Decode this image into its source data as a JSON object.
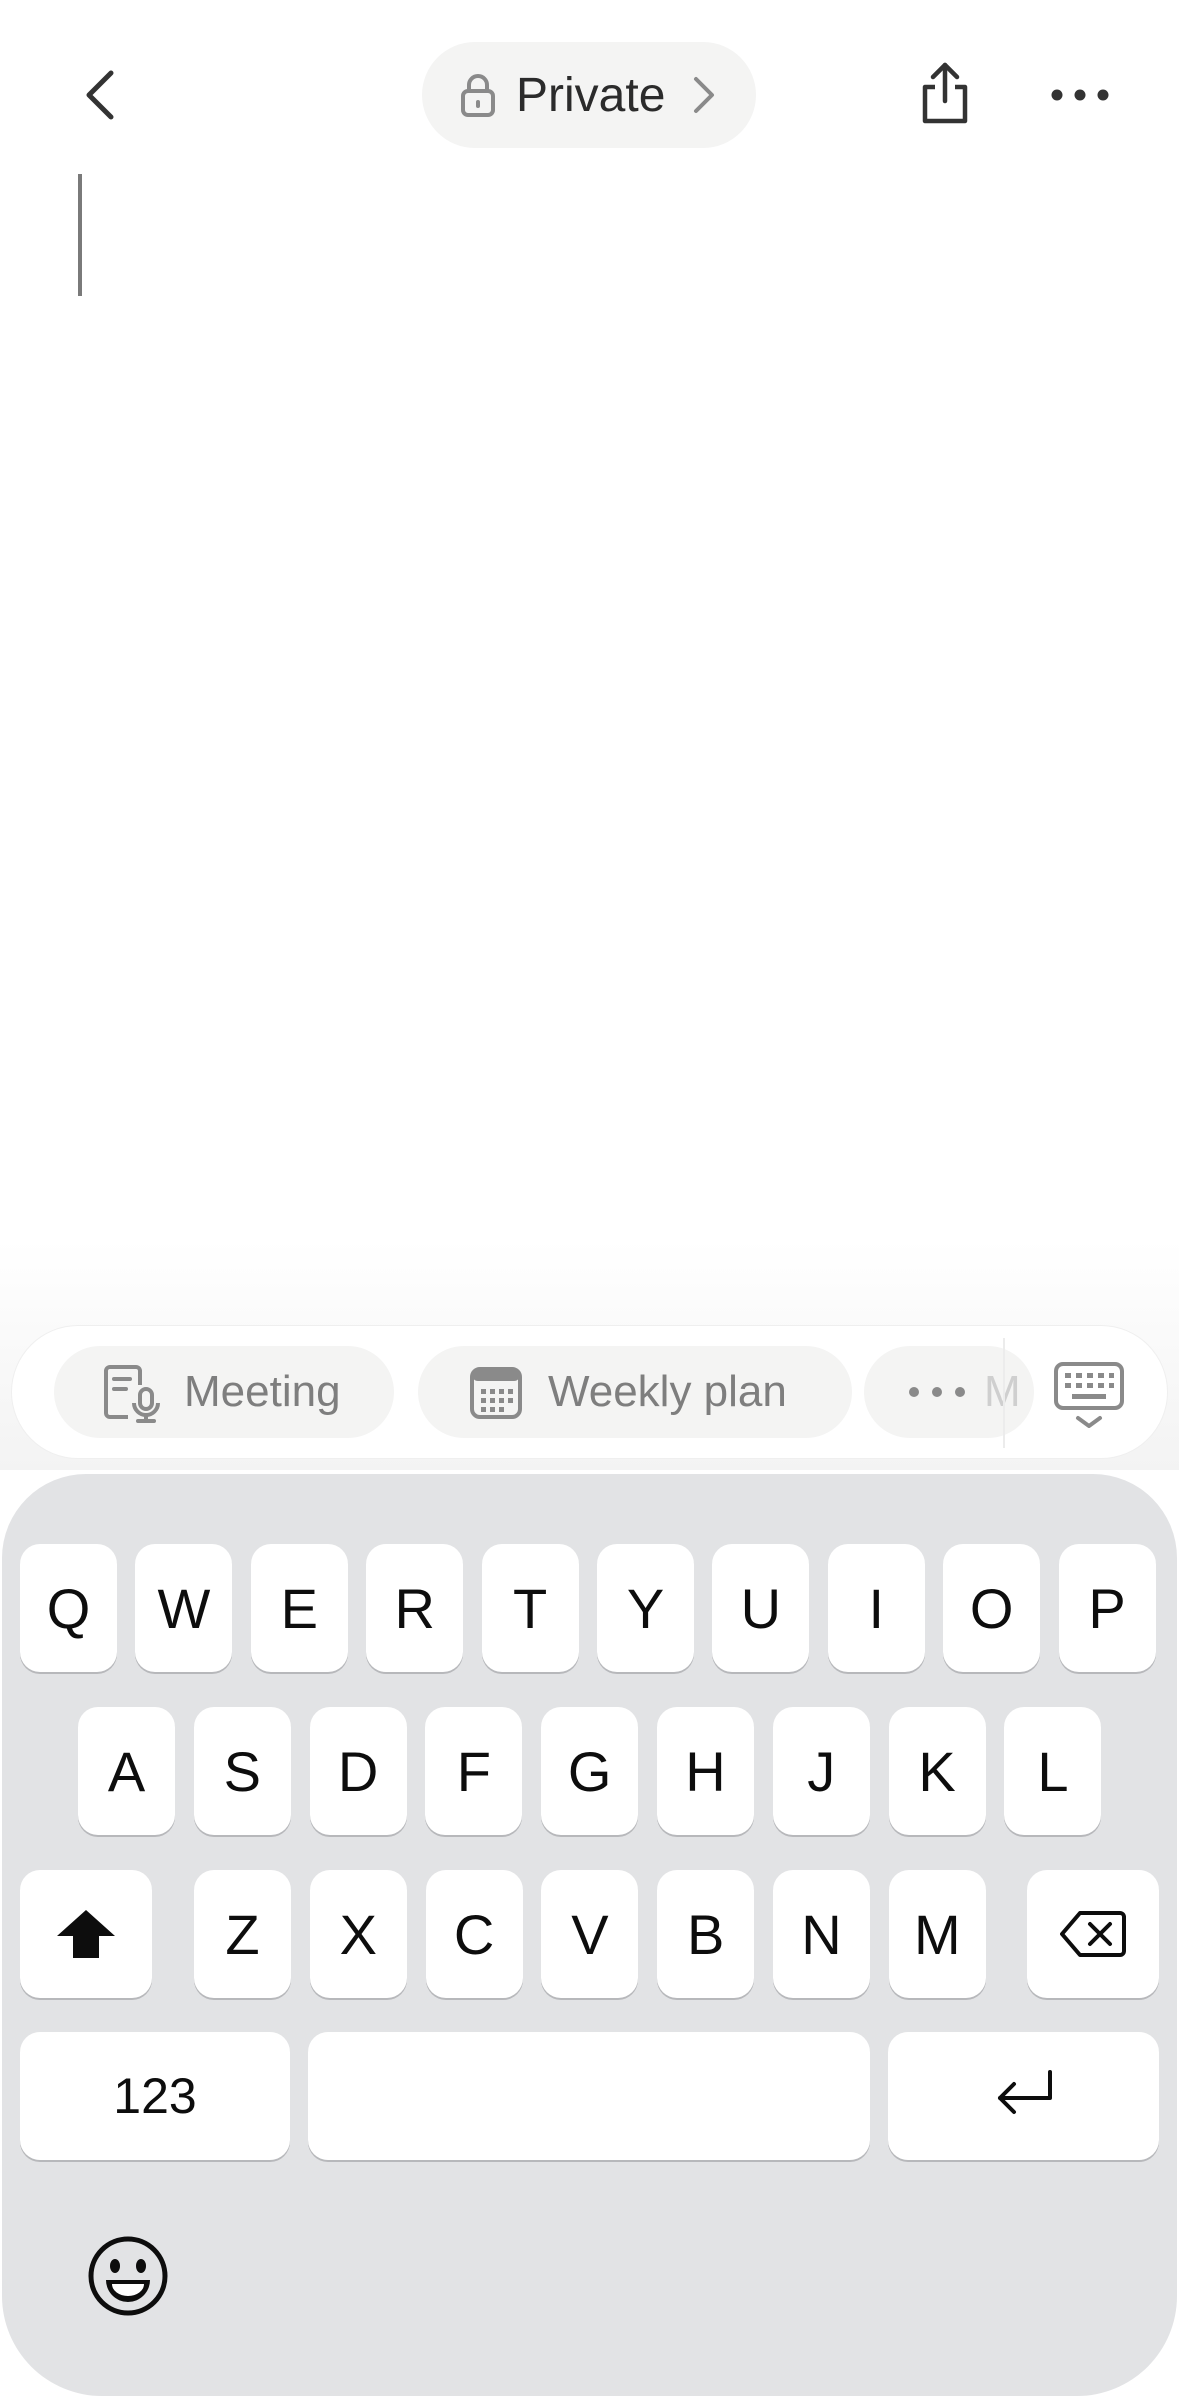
{
  "header": {
    "privacy_label": "Private"
  },
  "icons": {
    "back": "chevron-left-icon",
    "lock": "lock-icon",
    "pill_chevron": "chevron-right-icon",
    "share": "share-icon",
    "more": "more-horizontal-icon",
    "meeting": "meeting-notes-icon",
    "weekly": "calendar-icon",
    "keyboard_hide": "keyboard-hide-icon",
    "shift": "shift-icon",
    "delete": "backspace-icon",
    "return": "return-icon",
    "emoji": "emoji-icon"
  },
  "templates": {
    "items": [
      {
        "label": "Meeting"
      },
      {
        "label": "Weekly plan"
      },
      {
        "label": "M"
      }
    ]
  },
  "keyboard": {
    "row1": [
      "Q",
      "W",
      "E",
      "R",
      "T",
      "Y",
      "U",
      "I",
      "O",
      "P"
    ],
    "row2": [
      "A",
      "S",
      "D",
      "F",
      "G",
      "H",
      "J",
      "K",
      "L"
    ],
    "row3": [
      "Z",
      "X",
      "C",
      "V",
      "B",
      "N",
      "M"
    ],
    "numbers_label": "123",
    "space_label": ""
  },
  "colors": {
    "keyboard_bg": "#e2e3e5",
    "key_bg": "#ffffff",
    "chip_bg": "#f4f4f3",
    "chip_text": "#7e7e7e"
  }
}
